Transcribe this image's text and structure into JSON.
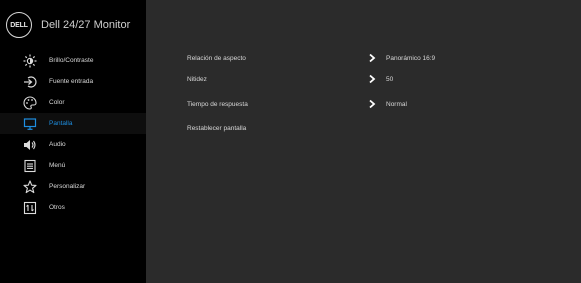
{
  "header": {
    "logo_text": "DELL",
    "title": "Dell 24/27 Monitor"
  },
  "sidebar": {
    "items": [
      {
        "label": "Brillo/Contraste",
        "icon": "brightness-icon"
      },
      {
        "label": "Fuente entrada",
        "icon": "input-source-icon"
      },
      {
        "label": "Color",
        "icon": "color-palette-icon"
      },
      {
        "label": "Pantalla",
        "icon": "display-icon",
        "active": true
      },
      {
        "label": "Audio",
        "icon": "speaker-icon"
      },
      {
        "label": "Menú",
        "icon": "menu-icon"
      },
      {
        "label": "Personalizar",
        "icon": "star-icon"
      },
      {
        "label": "Otros",
        "icon": "others-icon"
      }
    ]
  },
  "main": {
    "rows": [
      {
        "label": "Relación de aspecto",
        "value": "Panorámico 16:9"
      },
      {
        "label": "Nitidez",
        "value": "50"
      },
      {
        "label": "Tiempo de respuesta",
        "value": "Normal"
      },
      {
        "label": "Restablecer pantalla",
        "value": ""
      }
    ]
  },
  "colors": {
    "sidebar_bg": "#000000",
    "main_bg": "#2b2b2b",
    "accent": "#1e8ee0",
    "text": "#d8d8d8"
  }
}
